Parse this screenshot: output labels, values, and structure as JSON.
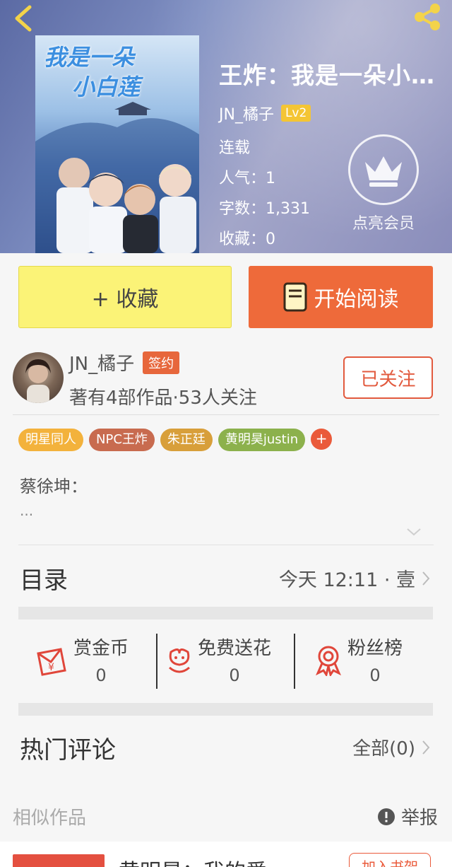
{
  "book": {
    "cover_title_line1": "我是一朵",
    "cover_title_line2": "小白莲",
    "title": "王炸：我是一朵小白莲",
    "author": "JN_橘子",
    "level": "Lv2",
    "status": "连载",
    "popularity": "人气：1",
    "word_count": "字数：1,331",
    "favorites": "收藏：0"
  },
  "vip": {
    "label": "点亮会员"
  },
  "actions": {
    "collect_label": "+ 收藏",
    "read_label": "开始阅读"
  },
  "author_panel": {
    "name": "JN_橘子",
    "badge": "签约",
    "stats": "著有4部作品·53人关注",
    "follow_label": "已关注"
  },
  "tags": [
    {
      "label": "明星同人",
      "color": "#f3b23c"
    },
    {
      "label": "NPC王炸",
      "color": "#c86b4f"
    },
    {
      "label": "朱正廷",
      "color": "#d89f3a"
    },
    {
      "label": "黄明昊justin",
      "color": "#8cb14c"
    }
  ],
  "tag_more": "+",
  "intro": {
    "text": "蔡徐坤：",
    "more": "..."
  },
  "catalog": {
    "label": "目录",
    "latest": "今天 12:11 · 壹"
  },
  "stats": [
    {
      "label": "赏金币",
      "value": "0",
      "icon": "red-envelope-icon"
    },
    {
      "label": "免费送花",
      "value": "0",
      "icon": "flower-icon"
    },
    {
      "label": "粉丝榜",
      "value": "0",
      "icon": "badge-icon"
    }
  ],
  "comments": {
    "label": "热门评论",
    "all": "全部(0)"
  },
  "similar": {
    "label": "相似作品",
    "report": "举报"
  },
  "next_item": {
    "title": "黄明昊：我的爱",
    "shelf": "加入书架"
  },
  "colors": {
    "accent_orange": "#ee6a3a",
    "collect_yellow": "#fbf377",
    "follow_red": "#e25a3e"
  }
}
